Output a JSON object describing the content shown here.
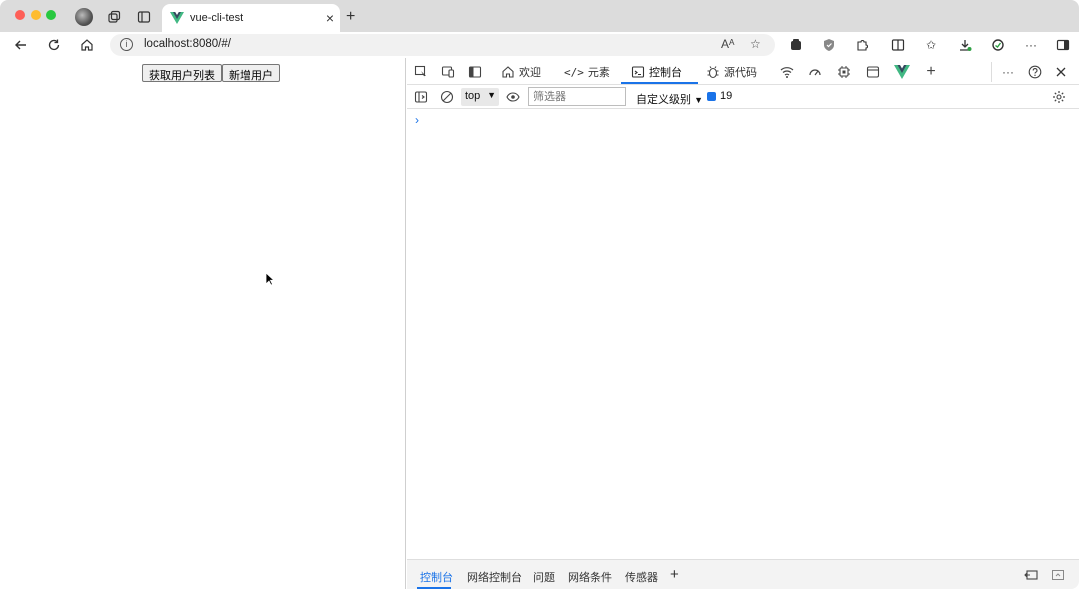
{
  "browser": {
    "tab": {
      "title": "vue-cli-test",
      "close": "×"
    },
    "new_tab": "+",
    "address": {
      "url": "localhost:8080/#/"
    }
  },
  "page": {
    "buttons": [
      {
        "label": "获取用户列表"
      },
      {
        "label": "新增用户"
      }
    ]
  },
  "devtools": {
    "tabs": [
      {
        "label": "欢迎",
        "icon": "home-icon"
      },
      {
        "label": "元素",
        "icon": "code-icon"
      },
      {
        "label": "控制台",
        "icon": "console-icon",
        "active": true
      },
      {
        "label": "源代码",
        "icon": "bug-icon"
      }
    ],
    "console": {
      "context": "top",
      "filter_placeholder": "筛选器",
      "levels": "自定义级别",
      "message_count": "19",
      "prompt": "›"
    },
    "drawer_tabs": [
      {
        "label": "控制台",
        "active": true
      },
      {
        "label": "网络控制台"
      },
      {
        "label": "问题"
      },
      {
        "label": "网络条件"
      },
      {
        "label": "传感器"
      }
    ],
    "drawer_add": "+"
  },
  "colors": {
    "accent": "#1a73e8",
    "tabstrip": "#dcdcdc",
    "traffic_red": "#fe5f57",
    "traffic_yellow": "#febc2e",
    "traffic_green": "#28c840"
  }
}
